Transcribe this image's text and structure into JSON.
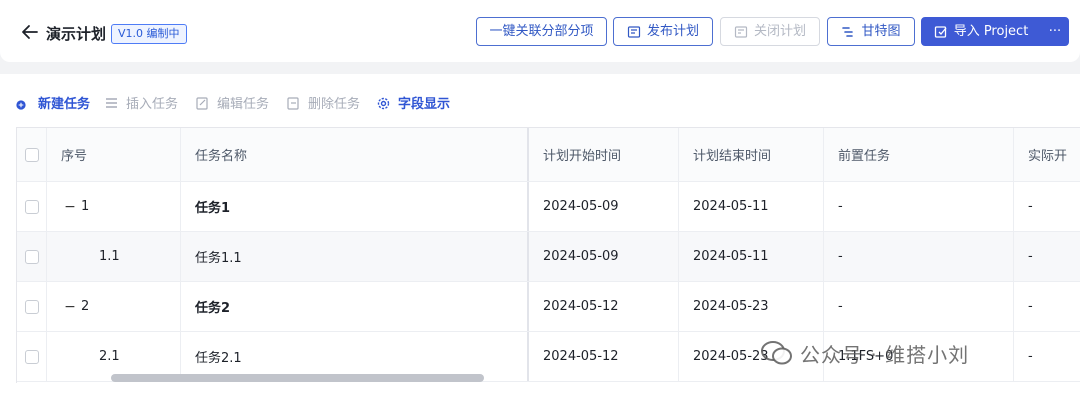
{
  "header": {
    "title": "演示计划",
    "version_badge": "V1.0 编制中",
    "buttons": {
      "link_all": "一键关联分部分项",
      "publish": "发布计划",
      "close": "关闭计划",
      "gantt": "甘特图",
      "import": "导入 Project",
      "more": "···"
    }
  },
  "toolbar": {
    "new_task": "新建任务",
    "insert_task": "插入任务",
    "edit_task": "编辑任务",
    "delete_task": "删除任务",
    "field_display": "字段显示"
  },
  "table": {
    "columns": [
      "序号",
      "任务名称",
      "计划开始时间",
      "计划结束时间",
      "前置任务",
      "实际开"
    ],
    "rows": [
      {
        "seq": "1",
        "name": "任务1",
        "start": "2024-05-09",
        "end": "2024-05-11",
        "pred": "-",
        "actual": "-"
      },
      {
        "seq": "1.1",
        "name": "任务1.1",
        "start": "2024-05-09",
        "end": "2024-05-11",
        "pred": "-",
        "actual": "-"
      },
      {
        "seq": "2",
        "name": "任务2",
        "start": "2024-05-12",
        "end": "2024-05-23",
        "pred": "-",
        "actual": "-"
      },
      {
        "seq": "2.1",
        "name": "任务2.1",
        "start": "2024-05-12",
        "end": "2024-05-23",
        "pred": "1.1FS+0",
        "actual": "-"
      }
    ],
    "collapse_symbol": "−"
  },
  "watermark": "公众号 · 维搭小刘",
  "colors": {
    "accent": "#3e5ad5",
    "link": "#2f55d4",
    "disabled": "#b4b9c4"
  }
}
